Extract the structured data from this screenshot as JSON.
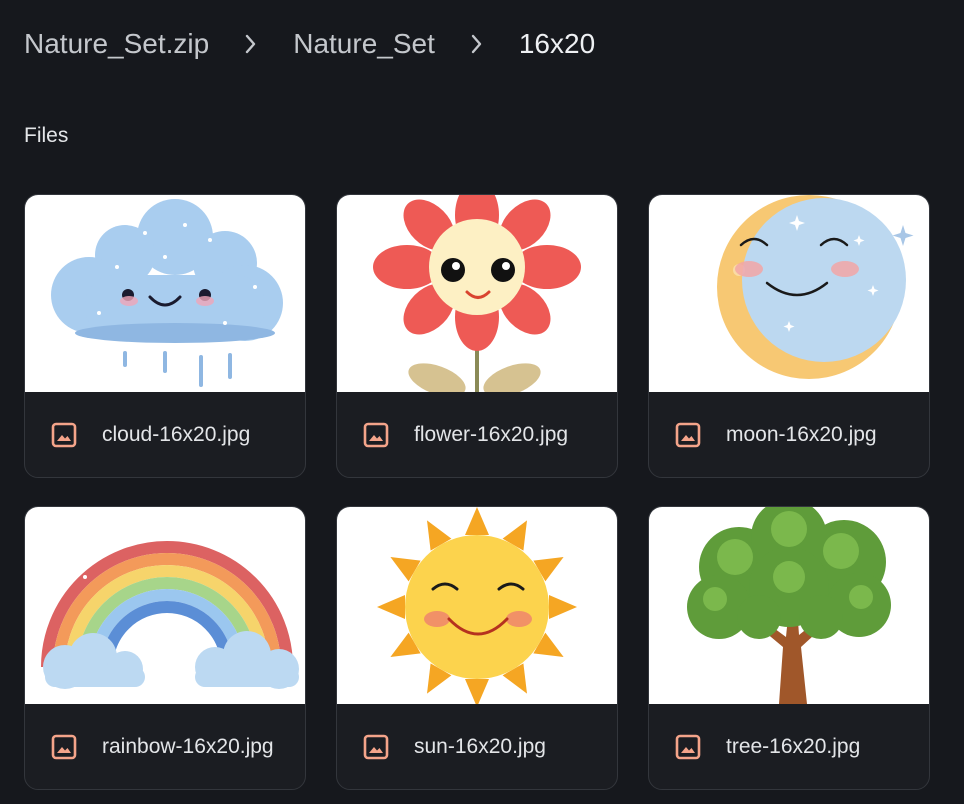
{
  "breadcrumb": {
    "items": [
      {
        "label": "Nature_Set.zip"
      },
      {
        "label": "Nature_Set"
      },
      {
        "label": "16x20"
      }
    ]
  },
  "section": {
    "title": "Files"
  },
  "files": [
    {
      "name": "cloud-16x20.jpg",
      "icon": "image-file-icon",
      "thumbnail": "cloud-image"
    },
    {
      "name": "flower-16x20.jpg",
      "icon": "image-file-icon",
      "thumbnail": "flower-image"
    },
    {
      "name": "moon-16x20.jpg",
      "icon": "image-file-icon",
      "thumbnail": "moon-image"
    },
    {
      "name": "rainbow-16x20.jpg",
      "icon": "image-file-icon",
      "thumbnail": "rainbow-image"
    },
    {
      "name": "sun-16x20.jpg",
      "icon": "image-file-icon",
      "thumbnail": "sun-image"
    },
    {
      "name": "tree-16x20.jpg",
      "icon": "image-file-icon",
      "thumbnail": "tree-image"
    }
  ],
  "colors": {
    "background": "#16181d",
    "card": "#1b1d22",
    "file_icon": "#f4a48a"
  }
}
